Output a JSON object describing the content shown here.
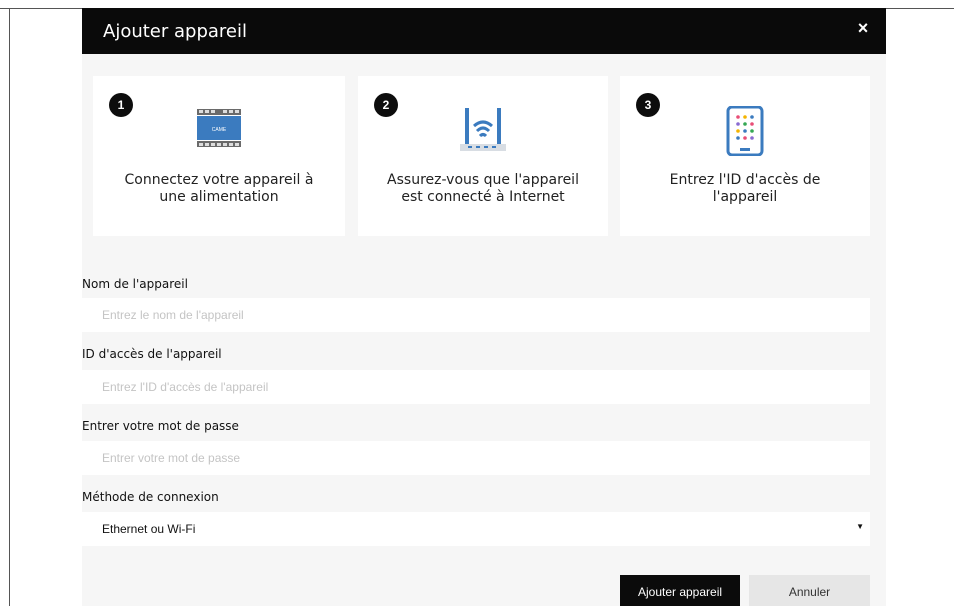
{
  "dialog": {
    "title": "Ajouter appareil",
    "close_symbol": "×"
  },
  "steps": [
    {
      "number": "1",
      "icon": "din-rail-module-icon",
      "text_line1": "Connectez votre appareil à",
      "text_line2": "une alimentation",
      "device_label": "CAME"
    },
    {
      "number": "2",
      "icon": "router-icon",
      "text_line1": "Assurez-vous que l'appareil",
      "text_line2": "est connecté à Internet"
    },
    {
      "number": "3",
      "icon": "tablet-keypad-icon",
      "text_line1": "Entrez l'ID d'accès de",
      "text_line2": "l'appareil"
    }
  ],
  "form": {
    "device_name": {
      "label": "Nom de l'appareil",
      "value": "",
      "placeholder": "Entrez le nom de l'appareil"
    },
    "access_id": {
      "label": "ID d'accès de l'appareil",
      "value": "",
      "placeholder": "Entrez l'ID d'accès de l'appareil"
    },
    "password": {
      "label": "Entrer votre mot de passe",
      "value": "",
      "placeholder": "Entrer votre mot de passe"
    },
    "connection_method": {
      "label": "Méthode de connexion",
      "selected": "Ethernet ou Wi-Fi"
    }
  },
  "actions": {
    "submit_label": "Ajouter appareil",
    "cancel_label": "Annuler"
  },
  "colors": {
    "header_bg": "#0a0a0a",
    "modal_bg": "#f6f6f6",
    "primary_button": "#0b0b0b",
    "secondary_button": "#e6e6e6",
    "icon_blue": "#3b7bbf"
  }
}
